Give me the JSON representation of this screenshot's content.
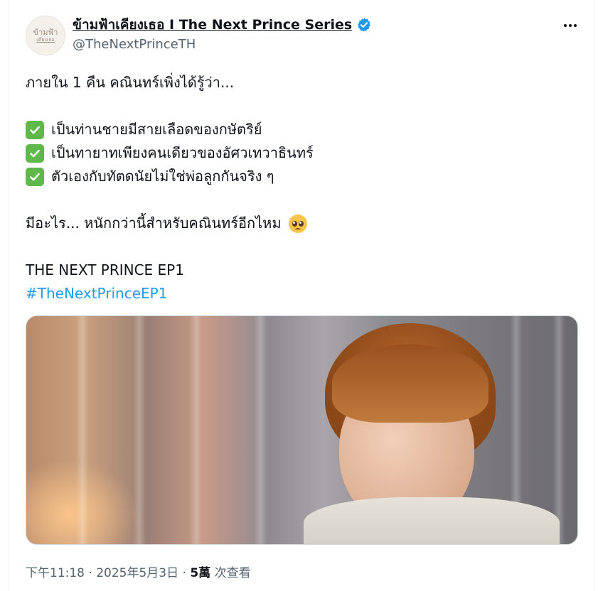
{
  "author": {
    "display_name": "ข้ามฟ้าเคียงเธอ I The Next Prince Series",
    "handle": "@TheNextPrinceTH",
    "avatar_logo_text": [
      "ข้ามฟ้า",
      "เคียงเธอ"
    ],
    "verified": true
  },
  "tweet": {
    "line1": "ภายใน 1 คืน คณินทร์เพิ่งได้รู้ว่า...",
    "checklist": [
      "เป็นท่านชายมีสายเลือดของกษัตริย์",
      "เป็นทายาทเพียงคนเดียวของอัศวเทวาธินทร์",
      "ตัวเองกับทัตดนัยไม่ใช่พ่อลูกกันจริง ๆ"
    ],
    "question": "มีอะไร... หนักกว่านี้สำหรับคณินทร์อีกไหม",
    "episode": "THE NEXT PRINCE EP1",
    "hashtag": "#TheNextPrinceEP1"
  },
  "meta": {
    "time": "下午11:18",
    "date": "2025年5月3日",
    "views_count": "5萬",
    "views_label": "次查看",
    "separator": "·"
  },
  "icons": {
    "verified": "verified-badge-icon",
    "more": "more-options-icon",
    "check": "check-mark-emoji",
    "emoji": "pleading-face-emoji"
  },
  "colors": {
    "accent": "#1d9bf0",
    "text": "#0f1419",
    "secondary": "#536471",
    "check_green": "#5fb94a"
  }
}
